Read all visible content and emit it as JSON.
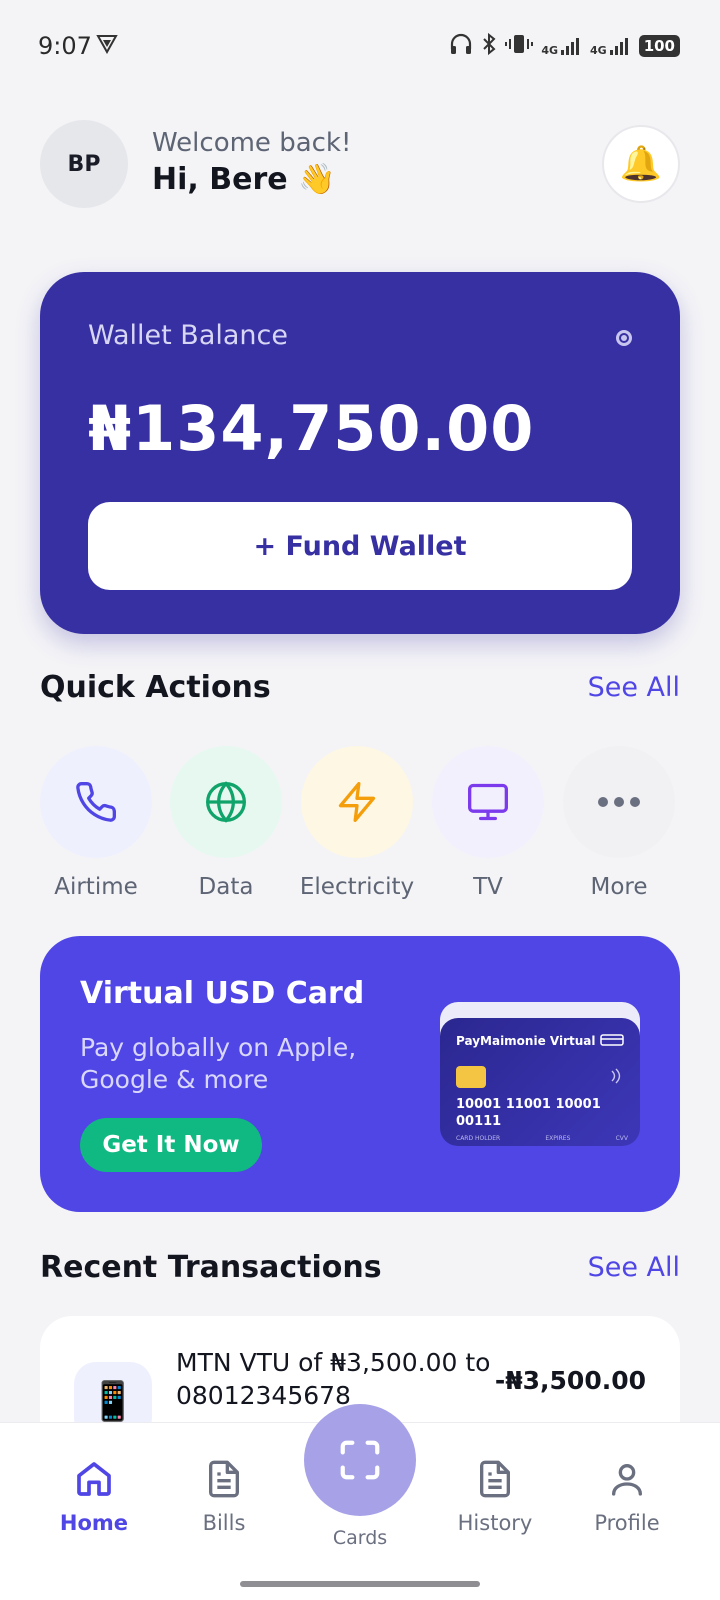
{
  "status": {
    "time": "9:07",
    "battery": "100",
    "net1": "4G",
    "net2": "4G"
  },
  "header": {
    "avatar_initials": "BP",
    "welcome": "Welcome back!",
    "greeting": "Hi, Bere 👋",
    "bell_icon": "🔔"
  },
  "wallet": {
    "label": "Wallet Balance",
    "amount": "₦134,750.00",
    "fund_label": "+ Fund Wallet"
  },
  "quick_actions": {
    "title": "Quick Actions",
    "see_all": "See All",
    "items": [
      {
        "label": "Airtime",
        "icon": "phone-icon",
        "bg": "#eef0fd",
        "color": "#4f46e5"
      },
      {
        "label": "Data",
        "icon": "globe-icon",
        "bg": "#e7f8f0",
        "color": "#10a36a"
      },
      {
        "label": "Electricity",
        "icon": "lightning-icon",
        "bg": "#fdf7e3",
        "color": "#f59e0b"
      },
      {
        "label": "TV",
        "icon": "monitor-icon",
        "bg": "#f3f0fd",
        "color": "#7c3aed"
      },
      {
        "label": "More",
        "icon": "more-icon",
        "bg": "#f1f1f4",
        "color": "#6b7080"
      }
    ]
  },
  "promo": {
    "title": "Virtual USD Card",
    "subtitle": "Pay globally on Apple, Google & more",
    "button": "Get It Now",
    "card_brand": "PayMaimonie Virtual",
    "card_number": "10001 11001 10001 00111",
    "card_holder": "CARD HOLDER",
    "expires": "EXPIRES",
    "cvv": "CVV"
  },
  "transactions": {
    "title": "Recent Transactions",
    "see_all": "See All",
    "items": [
      {
        "description": "MTN VTU of ₦3,500.00 to 08012345678",
        "amount": "-₦3,500.00",
        "icon": "📱"
      }
    ]
  },
  "nav": {
    "home": "Home",
    "bills": "Bills",
    "cards": "Cards",
    "history": "History",
    "profile": "Profile",
    "active_color": "#4f46e5"
  }
}
